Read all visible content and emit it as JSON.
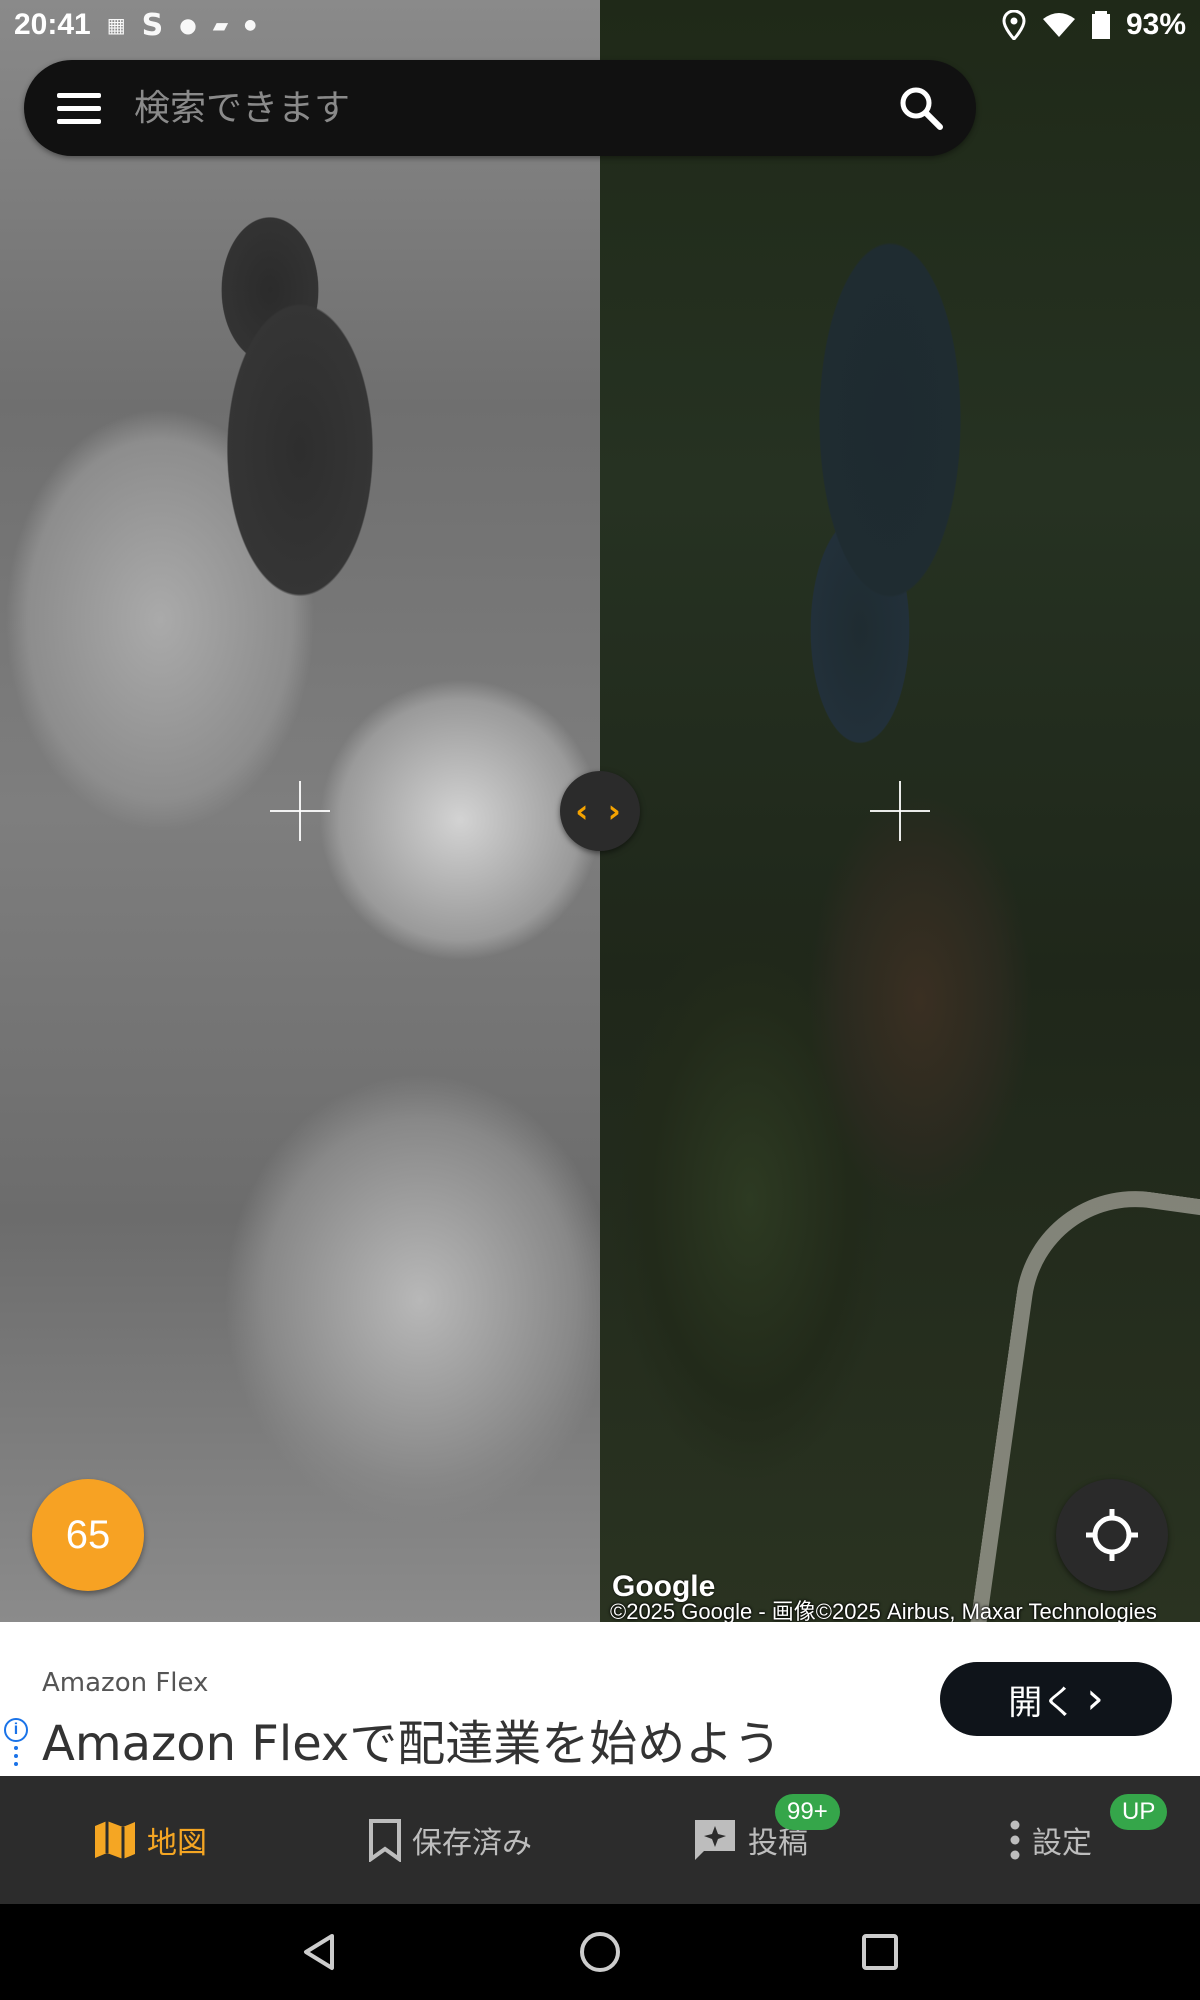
{
  "status_bar": {
    "time": "20:41",
    "notif_icons": [
      "temu-icon",
      "s-icon",
      "app-icon",
      "wm-icon",
      "dot-icon"
    ],
    "battery_percent": "93%"
  },
  "search": {
    "placeholder": "検索できます"
  },
  "map": {
    "divider_glyph": "‹ ›",
    "year_badge": "65",
    "google_logo": "Google",
    "attribution": "©2025 Google - 画像©2025 Airbus, Maxar Technologies"
  },
  "ad": {
    "advertiser": "Amazon Flex",
    "headline": "Amazon Flexで配達業を始めよう",
    "info_glyph": "i",
    "open_label": "開く",
    "open_chevron": "›"
  },
  "bottom_nav": {
    "items": [
      {
        "label": "地図",
        "icon": "map-icon",
        "active": true
      },
      {
        "label": "保存済み",
        "icon": "bookmark-icon"
      },
      {
        "label": "投稿",
        "icon": "post-icon",
        "badge": "99+"
      },
      {
        "label": "設定",
        "icon": "more-vert-icon",
        "badge": "UP"
      }
    ]
  },
  "colors": {
    "accent": "#F5A623",
    "badge_green": "#35A64A",
    "nav_bg": "#2C2C2C"
  }
}
